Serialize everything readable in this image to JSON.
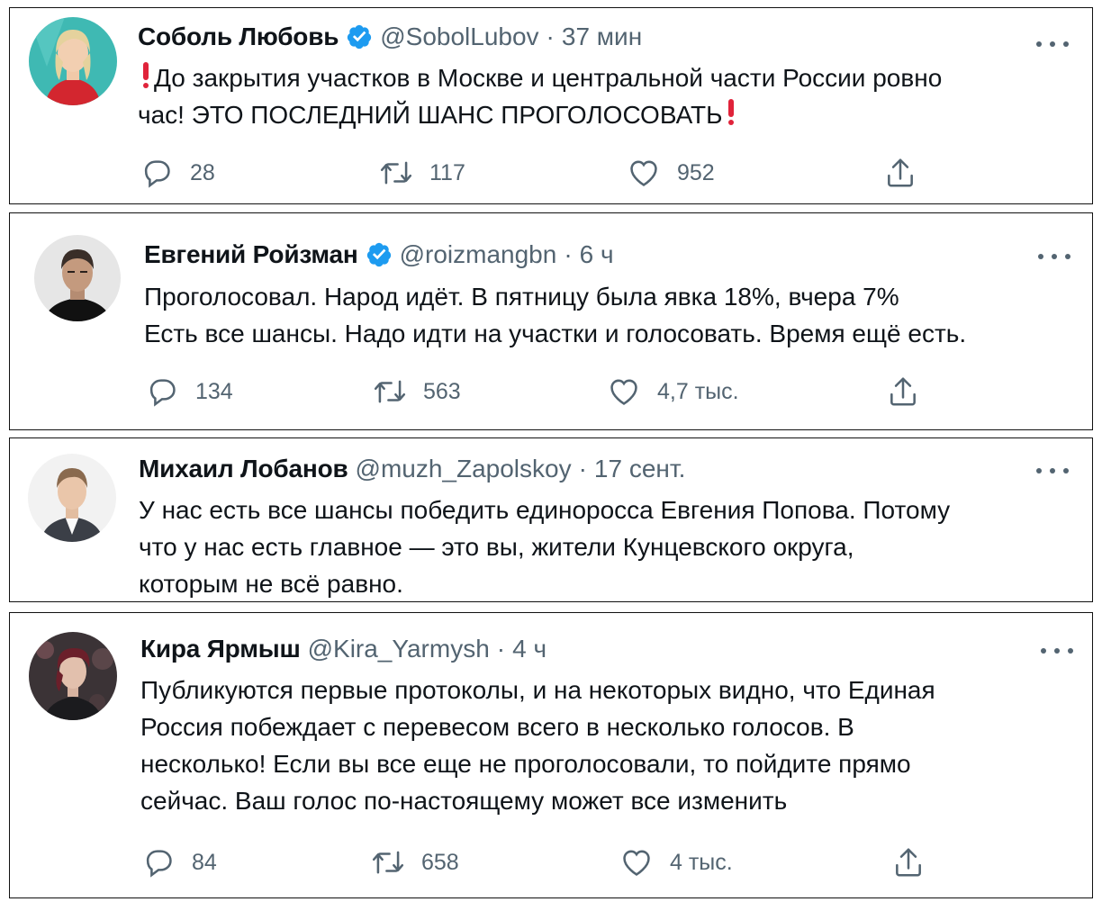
{
  "tweets": [
    {
      "name": "Соболь Любовь",
      "verified": true,
      "handle": "@SobolLubov",
      "dot": "·",
      "time": "37 мин",
      "text_line1_pre": "",
      "text_line1": "До закрытия участков в Москве и центральной части России ровно",
      "text_line2": "час! ЭТО ПОСЛЕДНИЙ ШАНС ПРОГОЛОСОВАТЬ",
      "replies": "28",
      "retweets": "117",
      "likes": "952"
    },
    {
      "name": "Евгений Ройзман",
      "verified": true,
      "handle": "@roizmangbn",
      "dot": "·",
      "time": "6 ч",
      "text": "Проголосовал. Народ идёт. В пятницу была явка 18%, вчера 7%\nЕсть все шансы. Надо идти на участки и голосовать. Время ещё есть.",
      "replies": "134",
      "retweets": "563",
      "likes": "4,7 тыс."
    },
    {
      "name": "Михаил Лобанов",
      "verified": false,
      "handle": "@muzh_Zapolskoy",
      "dot": "·",
      "time": "17 сент.",
      "text": "У нас есть все шансы победить единоросса Евгения Попова. Потому\nчто у нас есть главное — это вы, жители Кунцевского округа,\nкоторым не всё равно."
    },
    {
      "name": "Кира Ярмыш",
      "verified": false,
      "handle": "@Kira_Yarmysh",
      "dot": "·",
      "time": "4 ч",
      "text": "Публикуются первые протоколы, и на некоторых видно, что Единая\nРоссия побеждает с перевесом всего в несколько голосов. В\nнесколько! Если вы все еще не проголосовали, то пойдите прямо\nсейчас. Ваш голос по-настоящему может все изменить",
      "replies": "84",
      "retweets": "658",
      "likes": "4 тыс."
    }
  ],
  "icons": {
    "reply": "reply-icon",
    "retweet": "retweet-icon",
    "like": "like-icon",
    "share": "share-icon",
    "more": "more-icon",
    "verified": "verified-badge-icon"
  },
  "colors": {
    "text": "#0f1419",
    "secondary": "#536471",
    "verified": "#1d9bf0",
    "exclamation": "#e0233a",
    "border": "#111111"
  }
}
